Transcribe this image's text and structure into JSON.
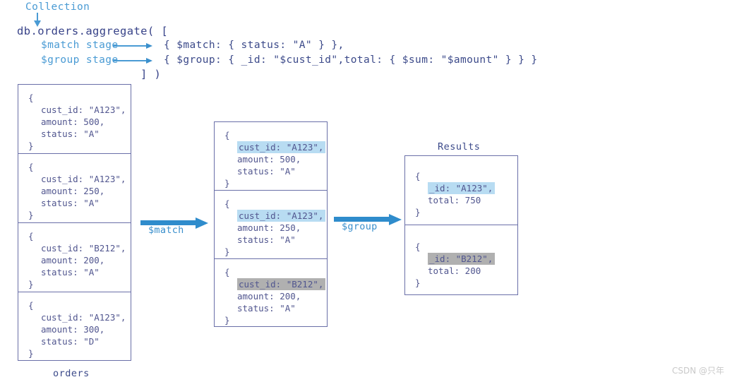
{
  "header": {
    "collection_label": "Collection",
    "code_line1": "db.orders.aggregate( [",
    "match_stage_label": "$match stage",
    "group_stage_label": "$group stage",
    "code_match": "{ $match: { status: \"A\" } },",
    "code_group": "{ $group: { _id: \"$cust_id\",total: { $sum: \"$amount\" } } }",
    "code_close": "] )"
  },
  "collection": {
    "caption": "orders",
    "documents": [
      {
        "open": "{",
        "lines": [
          "cust_id: \"A123\",",
          "amount: 500,",
          "status: \"A\""
        ],
        "close": "}"
      },
      {
        "open": "{",
        "lines": [
          "cust_id: \"A123\",",
          "amount: 250,",
          "status: \"A\""
        ],
        "close": "}"
      },
      {
        "open": "{",
        "lines": [
          "cust_id: \"B212\",",
          "amount: 200,",
          "status: \"A\""
        ],
        "close": "}"
      },
      {
        "open": "{",
        "lines": [
          "cust_id: \"A123\",",
          "amount: 300,",
          "status: \"D\""
        ],
        "close": "}"
      }
    ]
  },
  "matched": {
    "documents": [
      {
        "open": "{",
        "highlight": "cust_id: \"A123\",",
        "highlight_color": "blue",
        "lines": [
          "amount: 500,",
          "status: \"A\""
        ],
        "close": "}"
      },
      {
        "open": "{",
        "highlight": "cust_id: \"A123\",",
        "highlight_color": "blue",
        "lines": [
          "amount: 250,",
          "status: \"A\""
        ],
        "close": "}"
      },
      {
        "open": "{",
        "highlight": "cust_id: \"B212\",",
        "highlight_color": "gray",
        "lines": [
          "amount: 200,",
          "status: \"A\""
        ],
        "close": "}"
      }
    ]
  },
  "results": {
    "caption": "Results",
    "documents": [
      {
        "open": "{",
        "highlight": "_id: \"A123\",",
        "highlight_color": "blue",
        "lines": [
          "total: 750"
        ],
        "close": "}"
      },
      {
        "open": "{",
        "highlight": "_id: \"B212\",",
        "highlight_color": "gray",
        "lines": [
          "total: 200"
        ],
        "close": "}"
      }
    ]
  },
  "arrows": {
    "match_label": "$match",
    "group_label": "$group"
  },
  "watermark": "CSDN @只年",
  "colors": {
    "code_blue": "#3c4a8a",
    "label_blue": "#4a9bd4",
    "arrow_blue": "#2f8ccc",
    "box_border": "#6a6fa8",
    "doc_text": "#51568f",
    "highlight_blue": "#b8dcf2",
    "highlight_gray": "#b0b0b0"
  }
}
